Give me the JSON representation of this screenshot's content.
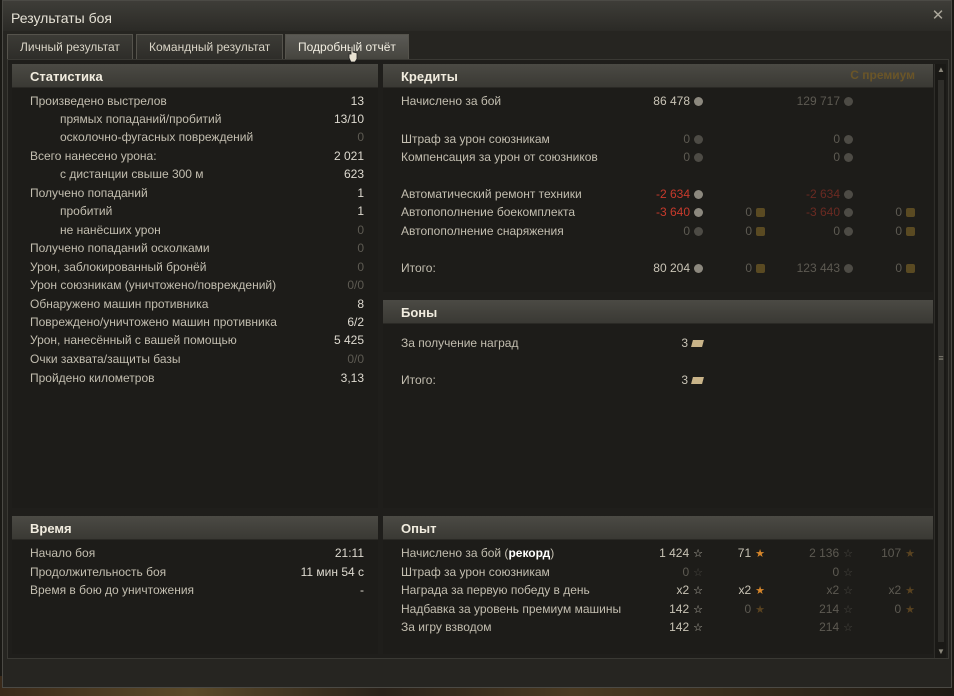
{
  "window": {
    "title": "Результаты боя",
    "close_glyph": "✕"
  },
  "tabs": [
    {
      "label": "Личный результат"
    },
    {
      "label": "Командный результат"
    },
    {
      "label": "Подробный отчёт"
    }
  ],
  "stats": {
    "title": "Статистика",
    "rows": [
      {
        "label": "Произведено выстрелов",
        "value": "13",
        "indent": false,
        "dim": false
      },
      {
        "label": "прямых попаданий/пробитий",
        "value": "13/10",
        "indent": true,
        "dim": false
      },
      {
        "label": "осколочно-фугасных повреждений",
        "value": "0",
        "indent": true,
        "dim": true
      },
      {
        "label": "Всего нанесено урона:",
        "value": "2 021",
        "indent": false,
        "dim": false
      },
      {
        "label": "с дистанции свыше 300 м",
        "value": "623",
        "indent": true,
        "dim": false
      },
      {
        "label": "Получено попаданий",
        "value": "1",
        "indent": false,
        "dim": false
      },
      {
        "label": "пробитий",
        "value": "1",
        "indent": true,
        "dim": false
      },
      {
        "label": "не нанёсших урон",
        "value": "0",
        "indent": true,
        "dim": true
      },
      {
        "label": "Получено попаданий осколками",
        "value": "0",
        "indent": false,
        "dim": true
      },
      {
        "label": "Урон, заблокированный бронёй",
        "value": "0",
        "indent": false,
        "dim": true
      },
      {
        "label": "Урон союзникам (уничтожено/повреждений)",
        "value": "0/0",
        "indent": false,
        "dim": true
      },
      {
        "label": "Обнаружено машин противника",
        "value": "8",
        "indent": false,
        "dim": false
      },
      {
        "label": "Повреждено/уничтожено машин противника",
        "value": "6/2",
        "indent": false,
        "dim": false
      },
      {
        "label": "Урон, нанесённый с вашей помощью",
        "value": "5 425",
        "indent": false,
        "dim": false
      },
      {
        "label": "Очки захвата/защиты базы",
        "value": "0/0",
        "indent": false,
        "dim": true
      },
      {
        "label": "Пройдено километров",
        "value": "3,13",
        "indent": false,
        "dim": false
      }
    ]
  },
  "credits": {
    "title": "Кредиты",
    "premium_label": "С премиум",
    "rows": [
      {
        "label": "Начислено за бой",
        "c1": "86 478",
        "c1s": "n",
        "g1": "",
        "c2": "129 717",
        "c2s": "d",
        "g2": ""
      },
      {
        "label": "Штраф за урон союзникам",
        "c1": "0",
        "c1s": "d",
        "g1": "",
        "c2": "0",
        "c2s": "d",
        "g2": ""
      },
      {
        "label": "Компенсация за урон от союзников",
        "c1": "0",
        "c1s": "d",
        "g1": "",
        "c2": "0",
        "c2s": "d",
        "g2": ""
      },
      {
        "label": "Автоматический ремонт техники",
        "c1": "-2 634",
        "c1s": "r",
        "g1": "",
        "c2": "-2 634",
        "c2s": "rd",
        "g2": ""
      },
      {
        "label": "Автопополнение боекомплекта",
        "c1": "-3 640",
        "c1s": "r",
        "g1": "0",
        "c2": "-3 640",
        "c2s": "rd",
        "g2": "0"
      },
      {
        "label": "Автопополнение снаряжения",
        "c1": "0",
        "c1s": "d",
        "g1": "0",
        "c2": "0",
        "c2s": "d",
        "g2": "0"
      },
      {
        "label": "Итого:",
        "c1": "80 204",
        "c1s": "n",
        "g1": "0",
        "c2": "123 443",
        "c2s": "d",
        "g2": "0"
      }
    ]
  },
  "bonds": {
    "title": "Боны",
    "rows": [
      {
        "label": "За получение наград",
        "value": "3"
      },
      {
        "label": "Итого:",
        "value": "3"
      }
    ]
  },
  "time": {
    "title": "Время",
    "rows": [
      {
        "label": "Начало боя",
        "value": "21:11"
      },
      {
        "label": "Продолжительность боя",
        "value": "11 мин 54 с"
      },
      {
        "label": "Время в бою до уничтожения",
        "value": "-"
      }
    ]
  },
  "xp": {
    "title": "Опыт",
    "rows": [
      {
        "label": "Начислено за бой (",
        "label_bold": "рекорд",
        "label_end": ")",
        "x1": "1 424",
        "x1s": "n",
        "f1": "71",
        "f1s": "n",
        "x2": "2 136",
        "x2s": "d",
        "f2": "107",
        "f2s": "d"
      },
      {
        "label": "Штраф за урон союзникам",
        "label_bold": "",
        "label_end": "",
        "x1": "0",
        "x1s": "d",
        "f1": "",
        "f1s": "",
        "x2": "0",
        "x2s": "d",
        "f2": "",
        "f2s": ""
      },
      {
        "label": "Награда за первую победу в день",
        "label_bold": "",
        "label_end": "",
        "x1": "x2",
        "x1s": "n",
        "f1": "x2",
        "f1s": "n",
        "x2": "x2",
        "x2s": "d",
        "f2": "x2",
        "f2s": "d"
      },
      {
        "label": "Надбавка за уровень премиум машины",
        "label_bold": "",
        "label_end": "",
        "x1": "142",
        "x1s": "n",
        "f1": "0",
        "f1s": "d",
        "x2": "214",
        "x2s": "d",
        "f2": "0",
        "f2s": "d"
      },
      {
        "label": "За игру взводом",
        "label_bold": "",
        "label_end": "",
        "x1": "142",
        "x1s": "n",
        "f1": "",
        "f1s": "",
        "x2": "214",
        "x2s": "d",
        "f2": "",
        "f2s": ""
      }
    ]
  },
  "icons": {
    "credit": "credit-coin-icon",
    "gold": "gold-icon",
    "xp": "xp-star-icon",
    "free_xp": "free-xp-star-icon",
    "bond": "bond-icon"
  },
  "colors": {
    "negative": "#c83a2c",
    "dim": "#5d5a52",
    "free_xp": "#d7862a"
  }
}
